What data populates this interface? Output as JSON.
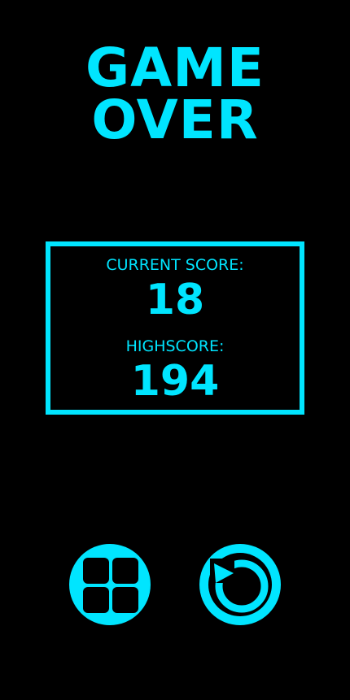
{
  "title": {
    "line1": "GAME",
    "line2": "OVER"
  },
  "scores": {
    "current_label": "CURRENT SCORE:",
    "current_value": "18",
    "high_label": "HIGHSCORE:",
    "high_value": "194"
  },
  "buttons": {
    "menu_icon": "grid-icon",
    "restart_icon": "restart-icon"
  },
  "colors": {
    "background": "#000000",
    "accent": "#00e5ff"
  }
}
